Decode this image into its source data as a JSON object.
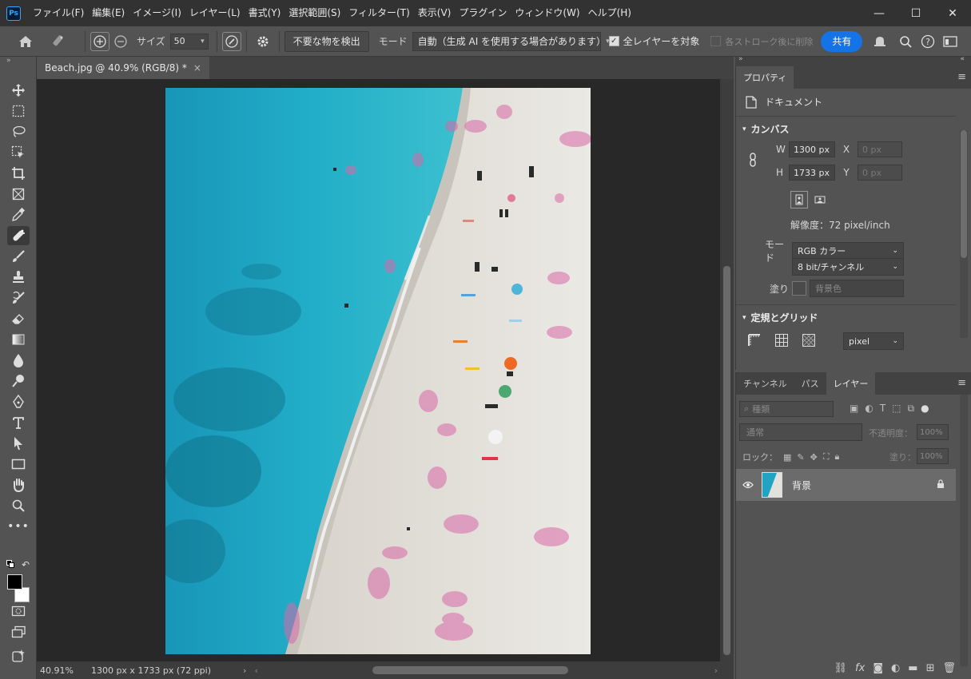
{
  "app": {
    "logo_text": "Ps",
    "menu": [
      "ファイル(F)",
      "編集(E)",
      "イメージ(I)",
      "レイヤー(L)",
      "書式(Y)",
      "選択範囲(S)",
      "フィルター(T)",
      "表示(V)",
      "プラグイン",
      "ウィンドウ(W)",
      "ヘルプ(H)"
    ],
    "window_controls": {
      "minimize": "—",
      "maximize": "☐",
      "close": "✕"
    }
  },
  "options": {
    "size_label": "サイズ",
    "size_value": "50",
    "detect_button": "不要な物を検出",
    "mode_label": "モード",
    "mode_value": "自動（生成 AI を使用する場合があります）",
    "all_layers_label": "全レイヤーを対象",
    "each_stroke_label": "各ストローク後に削除",
    "share_label": "共有"
  },
  "document": {
    "tab_title": "Beach.jpg @ 40.9% (RGB/8) *",
    "close_glyph": "×"
  },
  "status": {
    "zoom": "40.91%",
    "info": "1300 px x 1733 px (72 ppi)"
  },
  "properties": {
    "tab": "プロパティ",
    "doc_label": "ドキュメント",
    "canvas_header": "カンバス",
    "w_label": "W",
    "w_value": "1300 px",
    "h_label": "H",
    "h_value": "1733 px",
    "x_label": "X",
    "x_value": "0 px",
    "y_label": "Y",
    "y_value": "0 px",
    "resolution": "解像度：72 pixel/inch",
    "mode_label": "モード",
    "mode_value": "RGB カラー",
    "bitdepth_value": "8 bit/チャンネル",
    "fill_label": "塗り",
    "fill_value": "背景色",
    "rulers_header": "定規とグリッド",
    "units_value": "pixel"
  },
  "layers_panel": {
    "tabs": [
      "チャンネル",
      "パス",
      "レイヤー"
    ],
    "active_tab": 2,
    "filter_kind": "種類",
    "blend_mode": "通常",
    "opacity_label": "不透明度：",
    "opacity_value": "100%",
    "lock_label": "ロック：",
    "fill_label": "塗り：",
    "fill_value": "100%",
    "layers": [
      {
        "name": "背景",
        "visible": true,
        "locked": true
      }
    ]
  },
  "colors": {
    "accent": "#1473e6",
    "sea": "#1fa6c4",
    "sand": "#e6e4df",
    "highlight": "#d868a8"
  }
}
